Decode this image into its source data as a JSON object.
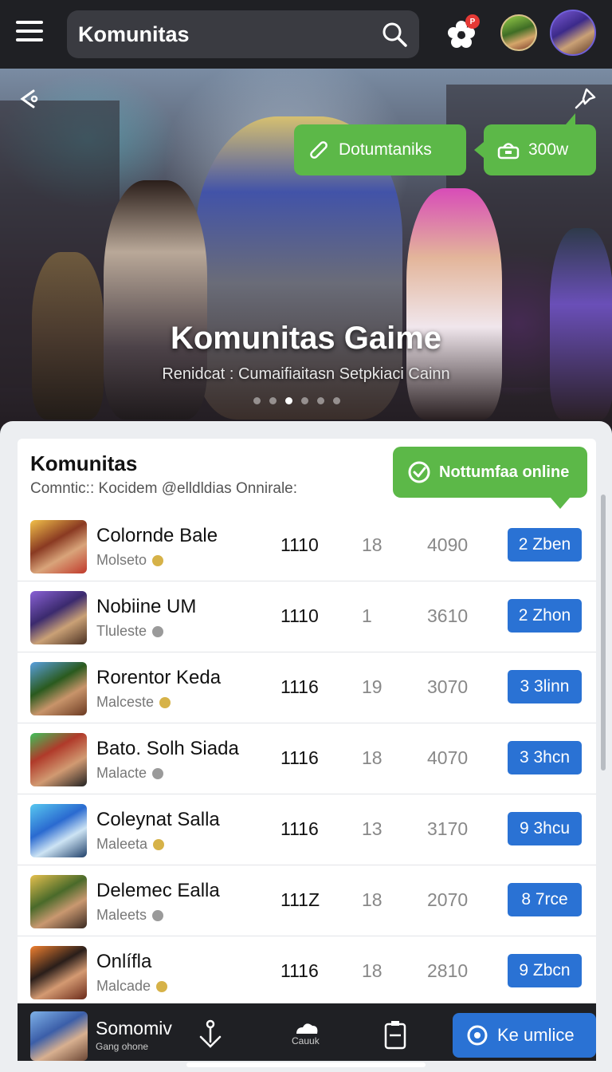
{
  "topbar": {
    "title": "Komunitas",
    "notif_badge": "P"
  },
  "hero": {
    "chip_left": "Dotumtaniks",
    "chip_right": "300w",
    "title": "Komunitas Gaime",
    "subtitle": "Renidcat : Cumaifiaitasn Setpkiaci Cainn",
    "slides": 6,
    "active_slide": 2
  },
  "card": {
    "title": "Komunitas",
    "subtitle": "Comntic:: Kocidem @elldldias Onnirale:",
    "online_label": "Nottumfaa online"
  },
  "rows": [
    {
      "name": "Colornde Bale",
      "meta": "Molseto",
      "c1": "1110",
      "c2": "18",
      "c3": "4090",
      "btn": "2 Zben"
    },
    {
      "name": "Nobiine UM",
      "meta": "Tluleste",
      "c1": "1110",
      "c2": "1",
      "c3": "3610",
      "btn": "2 Zhon"
    },
    {
      "name": "Rorentor Keda",
      "meta": "Malceste",
      "c1": "1116",
      "c2": "19",
      "c3": "3070",
      "btn": "3 3linn"
    },
    {
      "name": "Bato. Solh Siada",
      "meta": "Malacte",
      "c1": "1116",
      "c2": "18",
      "c3": "4070",
      "btn": "3 3hcn"
    },
    {
      "name": "Coleynat Salla",
      "meta": "Maleeta",
      "c1": "1116",
      "c2": "13",
      "c3": "3170",
      "btn": "9 3hcu"
    },
    {
      "name": "Delemec Ealla",
      "meta": "Maleets",
      "c1": "111Z",
      "c2": "18",
      "c3": "2070",
      "btn": "8 7rce"
    },
    {
      "name": "Onlífla",
      "meta": "Malcade",
      "c1": "1116",
      "c2": "18",
      "c3": "2810",
      "btn": "9 Zbcn"
    }
  ],
  "bottombar": {
    "name": "Somomiv",
    "sub": "Gang ohone",
    "icon2_label": "Cauuk",
    "live_label": "Ke umlice"
  },
  "colors": {
    "accent_green": "#5cb848",
    "accent_blue": "#2a72d4",
    "bar_dark": "#1f2024"
  }
}
